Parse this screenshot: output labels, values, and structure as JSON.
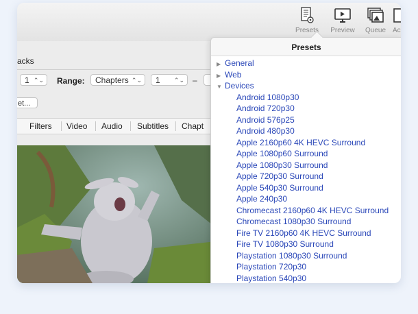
{
  "toolbar": {
    "items": [
      {
        "label": "Presets",
        "icon": "presets-icon"
      },
      {
        "label": "Preview",
        "icon": "preview-icon"
      },
      {
        "label": "Queue",
        "icon": "queue-icon"
      },
      {
        "label": "Ac",
        "icon": "activity-icon"
      }
    ]
  },
  "left": {
    "tracks_label": "acks",
    "angle_value": "1",
    "range_label": "Range:",
    "range_type": "Chapters",
    "range_start": "1",
    "dash": "–",
    "reset_button": "et...",
    "tabs": [
      "Filters",
      "Video",
      "Audio",
      "Subtitles",
      "Chapt"
    ]
  },
  "presets": {
    "title": "Presets",
    "groups": [
      {
        "label": "General",
        "expanded": false
      },
      {
        "label": "Web",
        "expanded": false
      },
      {
        "label": "Devices",
        "expanded": true
      }
    ],
    "devices": [
      "Android 1080p30",
      "Android 720p30",
      "Android 576p25",
      "Android 480p30",
      "Apple 2160p60 4K HEVC Surround",
      "Apple 1080p60 Surround",
      "Apple 1080p30 Surround",
      "Apple 720p30 Surround",
      "Apple 540p30 Surround",
      "Apple 240p30",
      "Chromecast 2160p60 4K HEVC Surround",
      "Chromecast 1080p30 Surround",
      "Fire TV 2160p60 4K HEVC Surround",
      "Fire TV 1080p30 Surround",
      "Playstation 1080p30 Surround",
      "Playstation 720p30",
      "Playstation 540p30"
    ],
    "link_color": "#2a47b8"
  }
}
